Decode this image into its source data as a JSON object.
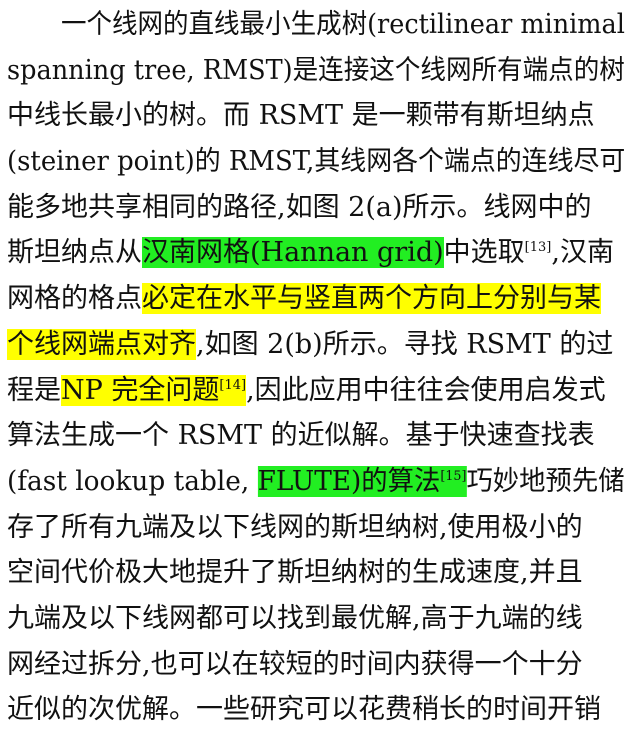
{
  "highlight_colors": {
    "green": "#22ee22",
    "yellow": "#ffff00"
  },
  "paragraph": {
    "l01": {
      "a": "一个线网的直线最小生成树(rectilinear minimal"
    },
    "l02": {
      "a": "spanning tree, RMST)是连接这个线网所有端点的树"
    },
    "l03": {
      "a": "中线长最小的树。而 RSMT 是一颗带有斯坦纳点"
    },
    "l04": {
      "a": "(steiner point)的 RMST,其线网各个端点的连线尽可"
    },
    "l05": {
      "a": "能多地共享相同的路径,如图 2(a)所示。线网中的"
    },
    "l06": {
      "a": "斯坦纳点从",
      "hl": "汉南网格(Hannan grid)",
      "b": "中选取",
      "sup": "[13]",
      "c": ",汉南"
    },
    "l07": {
      "a": "网格的格点",
      "hl": "必定在水平与竖直两个方向上分别与某"
    },
    "l08": {
      "hl": "个线网端点对齐",
      "a": ",如图 2(b)所示。寻找 RSMT 的过"
    },
    "l09": {
      "a": "程是",
      "hl": "NP 完全问题",
      "sup": "[14]",
      "b": ",因此应用中往往会使用启发式"
    },
    "l10": {
      "a": "算法生成一个 RSMT 的近似解。基于快速查找表"
    },
    "l11": {
      "a": "(fast lookup table,",
      "hl": "FLUTE)的算法",
      "sup": "[15]",
      "b": "巧妙地预先储"
    },
    "l12": {
      "a": "存了所有九端及以下线网的斯坦纳树,使用极小的"
    },
    "l13": {
      "a": "空间代价极大地提升了斯坦纳树的生成速度,并且"
    },
    "l14": {
      "a": "九端及以下线网都可以找到最优解,高于九端的线"
    },
    "l15": {
      "a": "网经过拆分,也可以在较短的时间内获得一个十分"
    },
    "l16": {
      "a": "近似的次优解。一些研究可以花费稍长的时间开销"
    }
  }
}
